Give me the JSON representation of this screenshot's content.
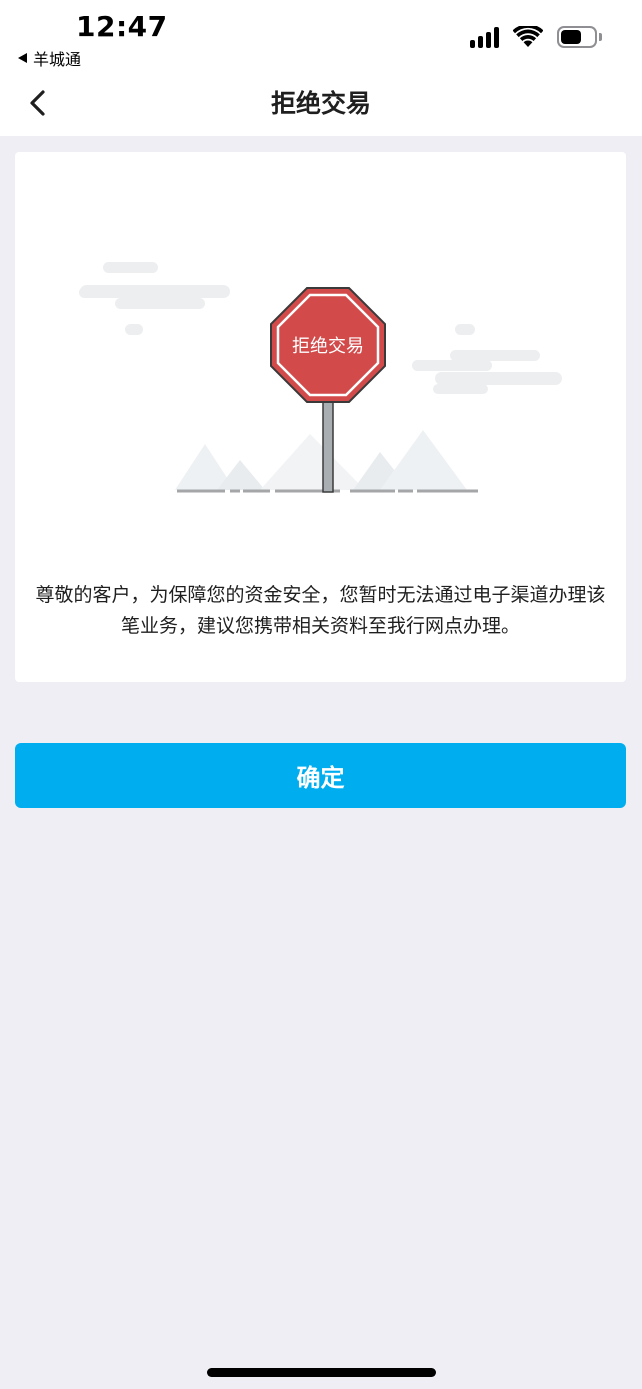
{
  "status_bar": {
    "time": "12:47",
    "back_app_label": "羊城通",
    "icons": [
      "signal-icon",
      "wifi-icon",
      "battery-icon"
    ]
  },
  "nav": {
    "title": "拒绝交易",
    "back_icon": "chevron-left-icon"
  },
  "illustration": {
    "sign_text": "拒绝交易",
    "sign_color": "#D24A4A",
    "icon": "stop-sign-icon"
  },
  "message": {
    "line1": "尊敬的客户，为保障您的资金安全，您暂时无法通过电子渠道办理该",
    "line2": "笔业务，建议您携带相关资料至我行网点办理。"
  },
  "actions": {
    "confirm_label": "确定"
  },
  "colors": {
    "accent": "#00AEEF",
    "background": "#EEEEF4",
    "card": "#FFFFFF",
    "stop_sign": "#D24A4A"
  }
}
